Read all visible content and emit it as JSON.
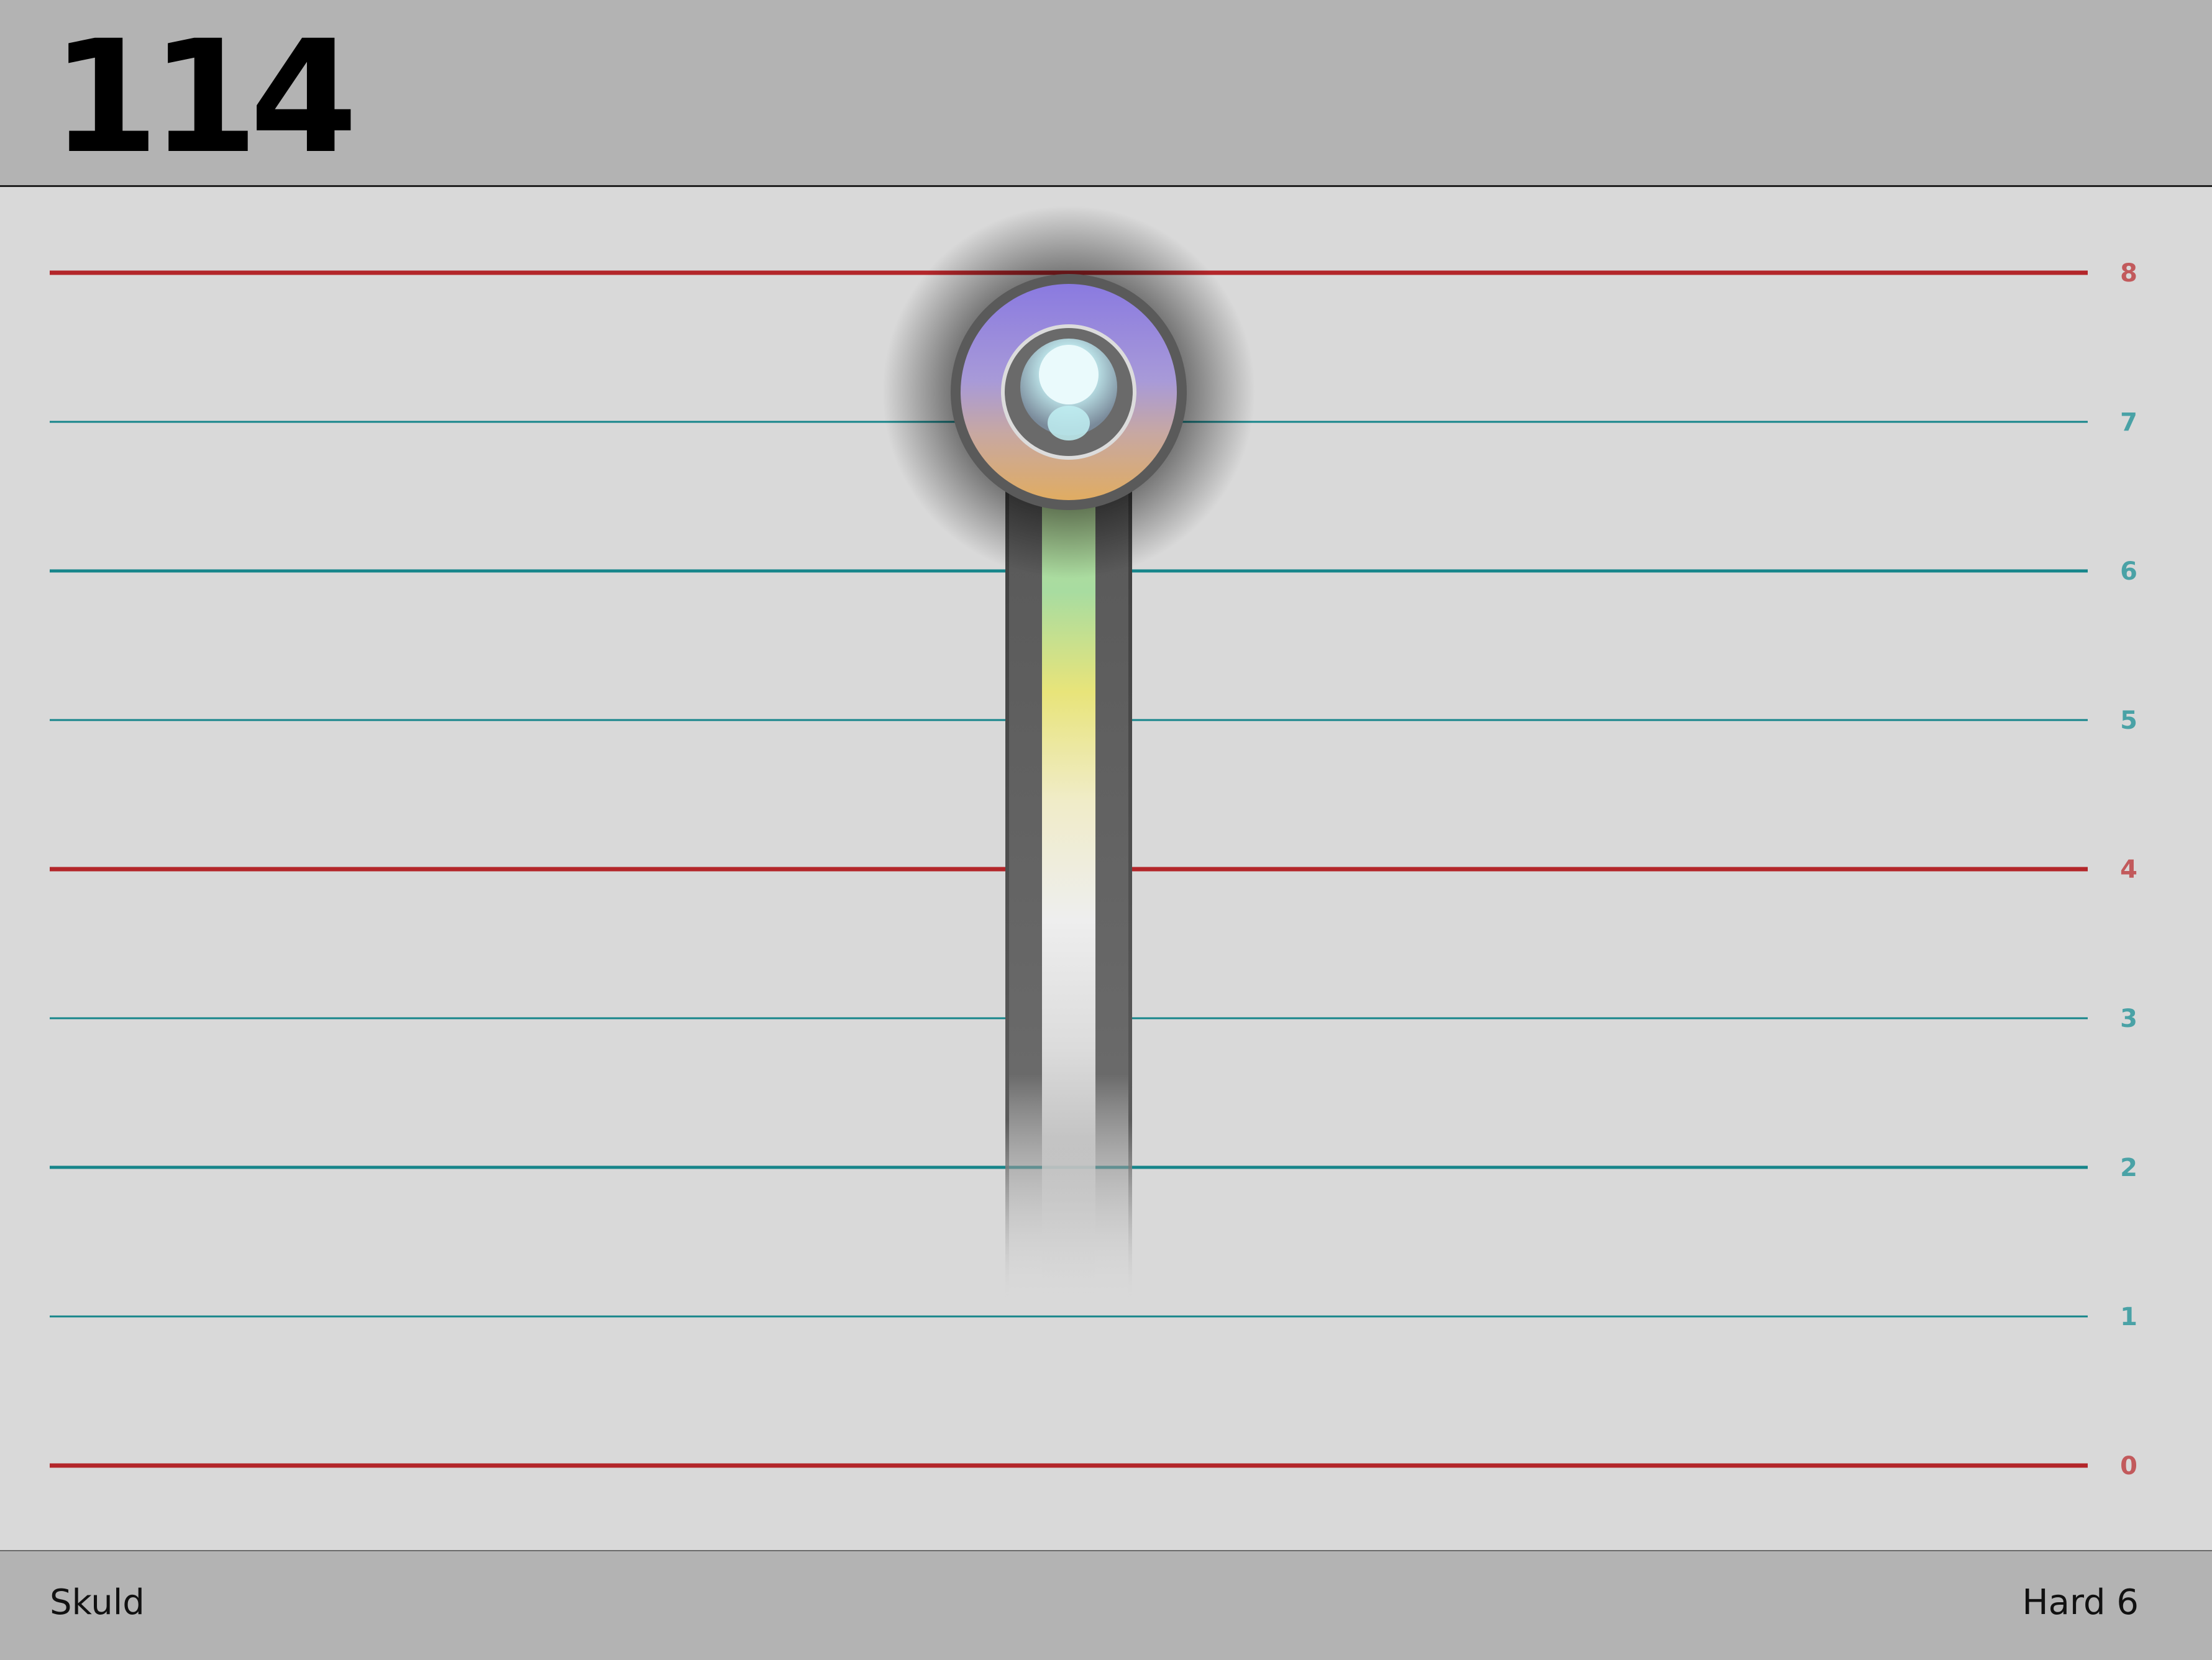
{
  "header": {
    "score": "114"
  },
  "footer": {
    "song_title": "Skuld",
    "difficulty": "Hard 6"
  },
  "lanes": {
    "labels": [
      "8",
      "7",
      "6",
      "5",
      "4",
      "3",
      "2",
      "1",
      "0"
    ],
    "major_color": "#b3262a",
    "minor_color": "#16858a",
    "major_label_color": "#c25a5c",
    "minor_label_color": "#4aa2a6"
  },
  "note": {
    "lane_value": 7.2,
    "tail_end_value": 1.1,
    "orb_color_top": "#8a7ae0",
    "orb_color_bottom": "#d8a86a"
  }
}
